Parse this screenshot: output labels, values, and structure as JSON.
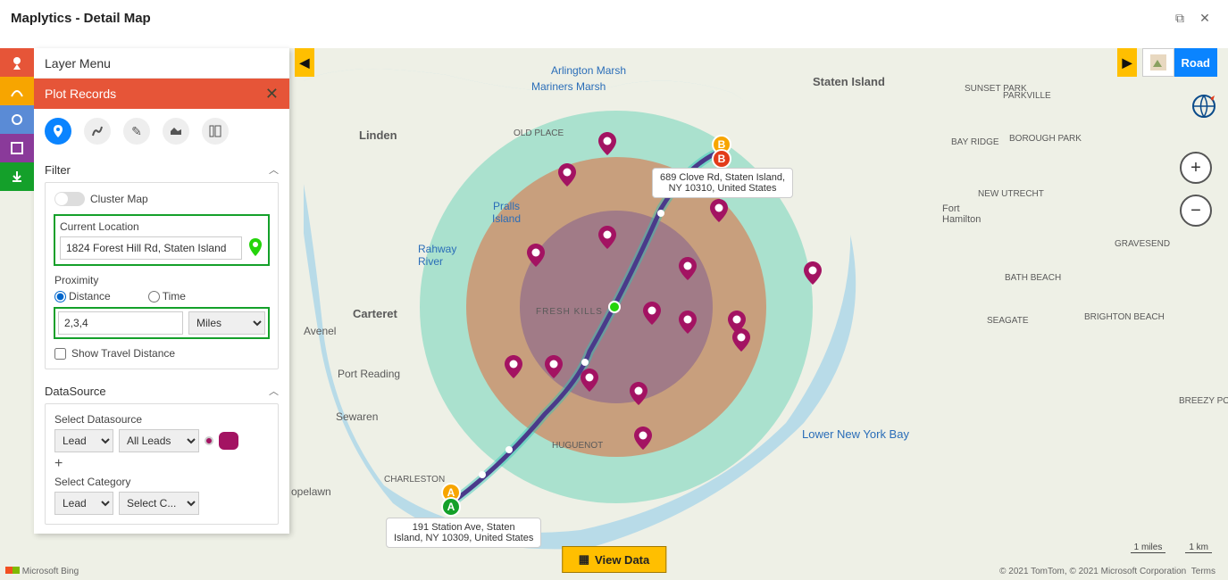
{
  "title": "Maplytics - Detail Map",
  "layerMenu": "Layer Menu",
  "plotRecords": "Plot Records",
  "filter": {
    "label": "Filter",
    "clusterMap": "Cluster Map",
    "curLocLabel": "Current Location",
    "curLocValue": "1824 Forest Hill Rd, Staten Island",
    "proximity": "Proximity",
    "distance": "Distance",
    "time": "Time",
    "proxValue": "2,3,4",
    "unitValue": "Miles",
    "showTravel": "Show Travel Distance"
  },
  "ds": {
    "label": "DataSource",
    "selectDs": "Select Datasource",
    "dsValue": "Lead",
    "viewValue": "All Leads",
    "selectCat": "Select Category",
    "catValue": "Lead",
    "catView": "Select C..."
  },
  "map": {
    "typeLayer": "Road",
    "viewData": "View Data",
    "scaleMiles": "1 miles",
    "scaleKm": "1 km",
    "credits": "© 2021 TomTom, © 2021 Microsoft Corporation",
    "terms": "Terms",
    "bing": "Microsoft Bing",
    "bay": "Lower New York Bay",
    "annotB": "689 Clove Rd, Staten Island,\nNY 10310, United States",
    "annotA": "191 Station Ave, Staten\nIsland, NY 10309, United States",
    "labels": {
      "statenIsland": "Staten Island",
      "arlingtonMarsh": "Arlington Marsh",
      "marinersMarsh": "Mariners Marsh",
      "oldPlace": "OLD PLACE",
      "pralls": "Pralls Island",
      "linden": "Linden",
      "rahway": "Rahway River",
      "carteret": "Carteret",
      "freshKills": "FRESH KILLS",
      "avenel": "Avenel",
      "portReading": "Port Reading",
      "sewaren": "Sewaren",
      "opelawn": "opelawn",
      "charleston": "CHARLESTON",
      "huguenot": "HUGUENOT",
      "sunsetPark": "SUNSET PARK",
      "bayRidge": "BAY RIDGE",
      "boroughPark": "BOROUGH PARK",
      "newUtrecht": "NEW UTRECHT",
      "fortHam": "Fort Hamilton",
      "gravesend": "GRAVESEND",
      "bathBeach": "BATH BEACH",
      "seagate": "SEAGATE",
      "brightonBeach": "BRIGHTON BEACH",
      "parkville": "PARKVILLE",
      "breezy": "BREEZY POI"
    }
  },
  "markers": {
    "A": "A",
    "B": "B"
  }
}
